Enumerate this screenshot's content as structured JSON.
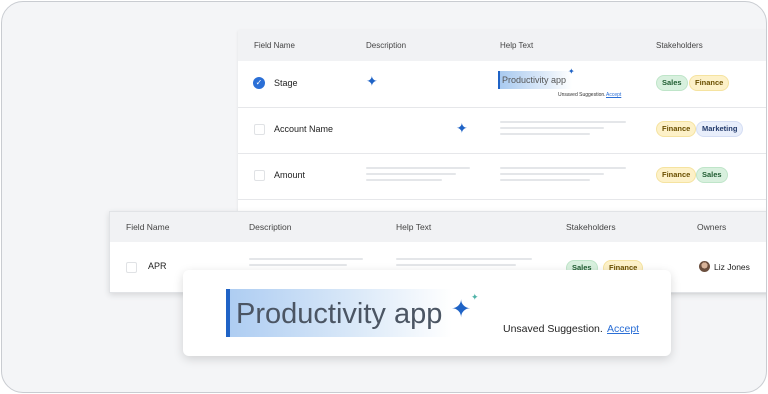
{
  "back_table": {
    "headers": {
      "field_name": "Field Name",
      "description": "Description",
      "help_text": "Help Text",
      "stakeholders": "Stakeholders"
    },
    "rows": [
      {
        "name": "Stage",
        "checked": true,
        "help_value": "Productivity app",
        "unsaved": "Unsaved Suggestion.",
        "accept": "Accept",
        "tags": [
          "Sales",
          "Finance"
        ]
      },
      {
        "name": "Account Name",
        "checked": false,
        "tags": [
          "Finance",
          "Marketing"
        ]
      },
      {
        "name": "Amount",
        "checked": false,
        "tags": [
          "Finance",
          "Sales"
        ]
      }
    ]
  },
  "mid_table": {
    "headers": {
      "field_name": "Field Name",
      "description": "Description",
      "help_text": "Help Text",
      "stakeholders": "Stakeholders",
      "owners": "Owners"
    },
    "row": {
      "name": "APR",
      "tags": [
        "Sales",
        "Finance"
      ],
      "owner": "Liz Jones"
    }
  },
  "suggestion": {
    "value": "Productivity app",
    "unsaved_label": "Unsaved Suggestion.",
    "accept_label": "Accept"
  },
  "icons": {
    "sparkle": "sparkle-icon",
    "check": "check-circle-icon",
    "avatar": "avatar"
  },
  "colors": {
    "accent": "#1f63c6",
    "sales": "#d8f0de",
    "finance": "#fdf1c8",
    "marketing": "#e8eefb"
  }
}
